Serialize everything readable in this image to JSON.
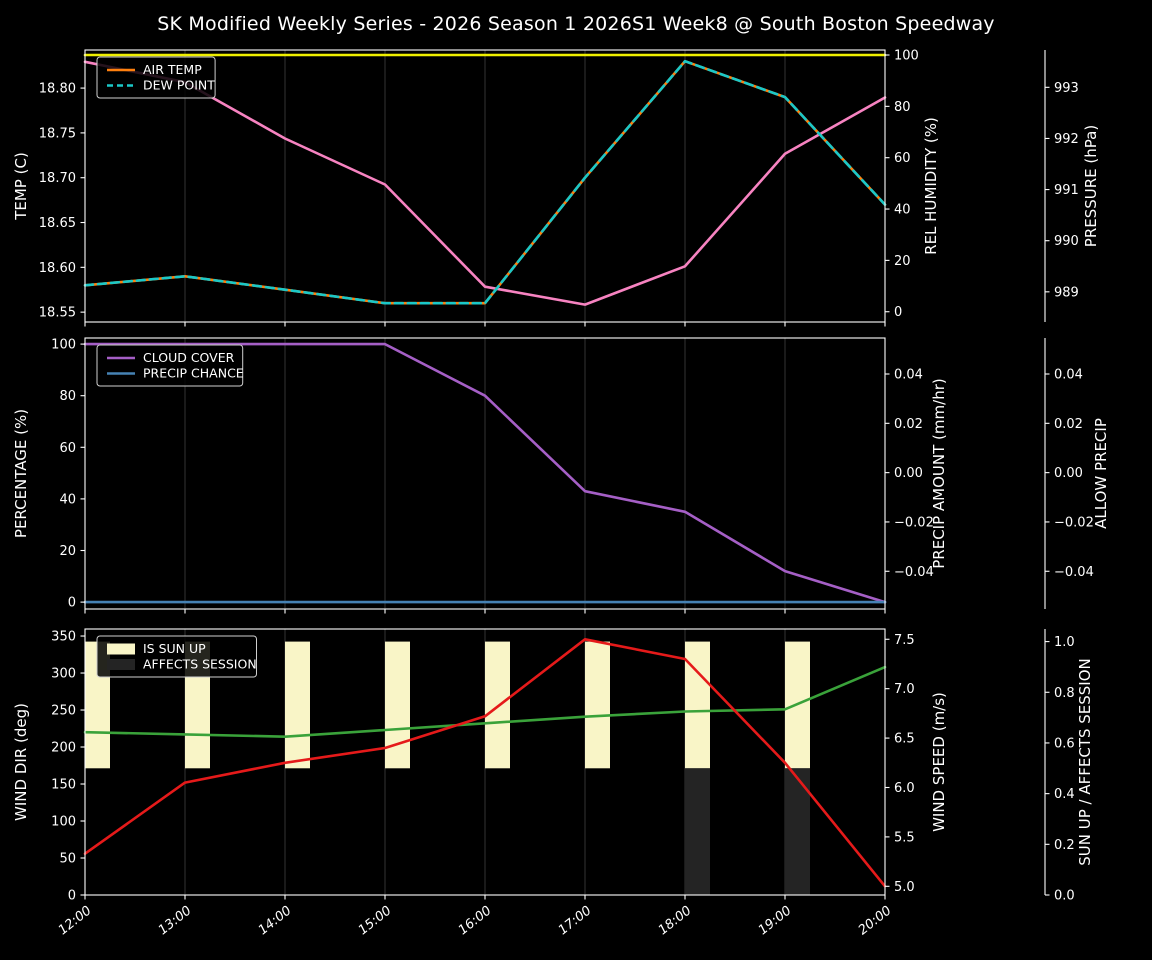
{
  "title": "SK Modified Weekly Series - 2026 Season 1 2026S1 Week8 @ South Boston Speedway",
  "figure": {
    "background": "#000000",
    "grid_color": "#343434",
    "spine_color": "#ffffff",
    "text_color": "#ffffff",
    "legend_border": "#cfcfcf"
  },
  "x_axis": {
    "hours": [
      12,
      13,
      14,
      15,
      16,
      17,
      18,
      19,
      20
    ],
    "labels": [
      "12:00",
      "13:00",
      "14:00",
      "15:00",
      "16:00",
      "17:00",
      "18:00",
      "19:00",
      "20:00"
    ]
  },
  "chart_data": [
    {
      "id": "temperature",
      "type": "line",
      "left_axis": {
        "label": "TEMP (C)",
        "color": "#ffffff",
        "tick_vals": [
          18.55,
          18.6,
          18.65,
          18.7,
          18.75,
          18.8
        ],
        "tick_labels": [
          "18.55",
          "18.60",
          "18.65",
          "18.70",
          "18.75",
          "18.80"
        ],
        "range": [
          18.539,
          18.8425
        ]
      },
      "right_axes": [
        {
          "label": "REL HUMIDITY (%)",
          "color": "#efef00",
          "tick_vals": [
            0,
            20,
            40,
            60,
            80,
            100
          ],
          "tick_labels": [
            "0",
            "20",
            "40",
            "60",
            "80",
            "100"
          ],
          "range": [
            -4.0,
            101.95
          ]
        },
        {
          "label": "PRESSURE (hPa)",
          "color": "#f783c1",
          "tick_vals": [
            989,
            990,
            991,
            992,
            993
          ],
          "tick_labels": [
            "989",
            "990",
            "991",
            "992",
            "993"
          ],
          "range": [
            988.41,
            993.73
          ]
        }
      ],
      "legend": [
        {
          "label": "AIR TEMP",
          "color": "#ff800e",
          "style": "line"
        },
        {
          "label": "DEW POINT",
          "color": "#1ac8c8",
          "style": "dashed"
        }
      ],
      "series": [
        {
          "name": "REL HUMIDITY",
          "type": "line",
          "axis": "R0",
          "color": "#efef00",
          "values": [
            100,
            100,
            100,
            100,
            100,
            100,
            100,
            100,
            100
          ]
        },
        {
          "name": "PRESSURE",
          "type": "line",
          "axis": "R1",
          "color": "#f783c1",
          "values": [
            993.5,
            993.1,
            992.0,
            991.1,
            989.1,
            988.75,
            989.5,
            991.7,
            992.8
          ]
        },
        {
          "name": "AIR TEMP",
          "type": "line",
          "axis": "L",
          "color": "#ff800e",
          "values": [
            18.58,
            18.59,
            18.575,
            18.56,
            18.56,
            18.7,
            18.83,
            18.79,
            18.67
          ]
        },
        {
          "name": "DEW POINT",
          "type": "line",
          "axis": "L",
          "color": "#1ac8c8",
          "dash": "8 5",
          "values": [
            18.58,
            18.59,
            18.575,
            18.56,
            18.56,
            18.7,
            18.83,
            18.79,
            18.67
          ]
        }
      ]
    },
    {
      "id": "percentage",
      "type": "line",
      "left_axis": {
        "label": "PERCENTAGE (%)",
        "color": "#ffffff",
        "tick_vals": [
          0,
          20,
          40,
          60,
          80,
          100
        ],
        "tick_labels": [
          "0",
          "20",
          "40",
          "60",
          "80",
          "100"
        ],
        "range": [
          -2.67,
          102.36
        ]
      },
      "right_axes": [
        {
          "label": "PRECIP AMOUNT (mm/hr)",
          "color": "#c66a2d",
          "tick_vals": [
            -0.04,
            -0.02,
            0.0,
            0.02,
            0.04
          ],
          "tick_labels": [
            "−0.04",
            "−0.02",
            "0.00",
            "0.02",
            "0.04"
          ],
          "range": [
            -0.0553,
            0.0546
          ]
        },
        {
          "label": "ALLOW PRECIP",
          "color": "#ffffff",
          "tick_vals": [
            -0.04,
            -0.02,
            0.0,
            0.02,
            0.04
          ],
          "tick_labels": [
            "−0.04",
            "−0.02",
            "0.00",
            "0.02",
            "0.04"
          ],
          "range": [
            -0.0553,
            0.0546
          ]
        }
      ],
      "legend": [
        {
          "label": "CLOUD COVER",
          "color": "#a55fc6",
          "style": "line"
        },
        {
          "label": "PRECIP CHANCE",
          "color": "#4682b4",
          "style": "line"
        }
      ],
      "series": [
        {
          "name": "CLOUD COVER",
          "type": "line",
          "axis": "L",
          "color": "#a55fc6",
          "values": [
            100,
            100,
            100,
            100,
            80,
            43,
            35,
            12,
            0
          ]
        },
        {
          "name": "PRECIP CHANCE",
          "type": "line",
          "axis": "L",
          "color": "#4682b4",
          "values": [
            0,
            0,
            0,
            0,
            0,
            0,
            0,
            0,
            0
          ]
        }
      ]
    },
    {
      "id": "wind",
      "type": "line-bar",
      "left_axis": {
        "label": "WIND DIR (deg)",
        "color": "#3aa23a",
        "tick_vals": [
          0,
          50,
          100,
          150,
          200,
          250,
          300,
          350
        ],
        "tick_labels": [
          "0",
          "50",
          "100",
          "150",
          "200",
          "250",
          "300",
          "350"
        ],
        "range": [
          0,
          359.5
        ]
      },
      "right_axes": [
        {
          "label": "WIND SPEED (m/s)",
          "color": "#e51a1a",
          "tick_vals": [
            5.0,
            5.5,
            6.0,
            6.5,
            7.0,
            7.5
          ],
          "tick_labels": [
            "5.0",
            "5.5",
            "6.0",
            "6.5",
            "7.0",
            "7.5"
          ],
          "range": [
            4.912,
            7.604
          ]
        },
        {
          "label": "SUN UP / AFFECTS SESSION",
          "color": "#ffffff",
          "tick_vals": [
            0.0,
            0.2,
            0.4,
            0.6,
            0.8,
            1.0
          ],
          "tick_labels": [
            "0.0",
            "0.2",
            "0.4",
            "0.6",
            "0.8",
            "1.0"
          ],
          "range": [
            0,
            1.0497
          ]
        }
      ],
      "legend": [
        {
          "label": "IS SUN UP",
          "color": "#f9f5c7",
          "style": "patch"
        },
        {
          "label": "AFFECTS SESSION",
          "color": "#242424",
          "style": "patch"
        }
      ],
      "series": [
        {
          "name": "IS SUN UP",
          "type": "bar",
          "axis": "R1",
          "color": "#f9f5c7",
          "bar_bottom": 0.5,
          "bar_top": 1.0,
          "bar_width_hours": 0.25,
          "flags": [
            1,
            1,
            1,
            1,
            1,
            1,
            1,
            1,
            0
          ]
        },
        {
          "name": "AFFECTS SESSION",
          "type": "bar",
          "axis": "R1",
          "color": "#242424",
          "bar_bottom": 0.0,
          "bar_top": 0.5,
          "bar_width_hours": 0.25,
          "flags": [
            0,
            0,
            0,
            0,
            0,
            0,
            1,
            1,
            0
          ]
        },
        {
          "name": "WIND DIR",
          "type": "line",
          "axis": "L",
          "color": "#3aa23a",
          "values": [
            220,
            217,
            214,
            223,
            232,
            241,
            248,
            251,
            308
          ]
        },
        {
          "name": "WIND SPEED",
          "type": "line",
          "axis": "R0",
          "color": "#e51a1a",
          "values": [
            5.33,
            6.05,
            6.25,
            6.4,
            6.72,
            7.5,
            7.3,
            6.25,
            5.0
          ]
        }
      ]
    }
  ]
}
